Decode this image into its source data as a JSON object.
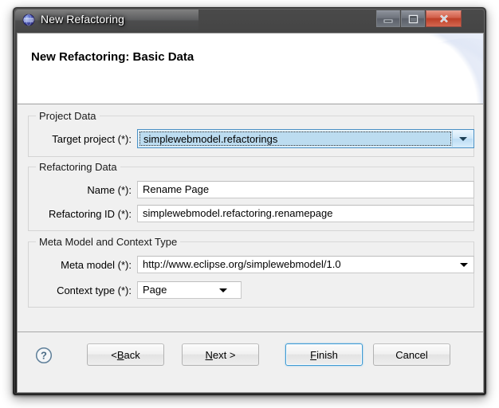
{
  "window": {
    "title": "New Refactoring",
    "icon": "eclipse-sphere-icon",
    "controls": {
      "minimize": "minimize-icon",
      "maximize": "maximize-icon",
      "close": "close-icon"
    }
  },
  "banner": {
    "title": "New Refactoring: Basic Data"
  },
  "groups": [
    {
      "title": "Project Data",
      "fields": [
        {
          "label": "Target project (*):",
          "value": "simplewebmodel.refactorings",
          "control": "combo",
          "focused": true,
          "selected": true
        }
      ]
    },
    {
      "title": "Refactoring Data",
      "fields": [
        {
          "label": "Name (*):",
          "value": "Rename Page",
          "control": "text"
        },
        {
          "label": "Refactoring ID (*):",
          "value": "simplewebmodel.refactoring.renamepage",
          "control": "text"
        }
      ]
    },
    {
      "title": "Meta Model and Context Type",
      "fields": [
        {
          "label": "Meta model (*):",
          "value": "http://www.eclipse.org/simplewebmodel/1.0",
          "control": "combo"
        },
        {
          "label": "Context type (*):",
          "value": "Page",
          "control": "combo"
        }
      ]
    }
  ],
  "footer": {
    "help": "?",
    "buttons": [
      {
        "name": "back",
        "prefix": "< ",
        "mnemonic": "B",
        "suffix": "ack",
        "default": false
      },
      {
        "name": "next",
        "prefix": "",
        "mnemonic": "N",
        "suffix": "ext >",
        "default": false
      },
      {
        "name": "finish",
        "prefix": "",
        "mnemonic": "F",
        "suffix": "inish",
        "default": true
      },
      {
        "name": "cancel",
        "prefix": "",
        "mnemonic": "",
        "suffix": "Cancel",
        "default": false
      }
    ]
  },
  "colors": {
    "accent": "#3c9ad4",
    "selection": "#bcdcf0",
    "dialog_bg": "#f0f0f0",
    "close_button": "#bd3f28"
  }
}
